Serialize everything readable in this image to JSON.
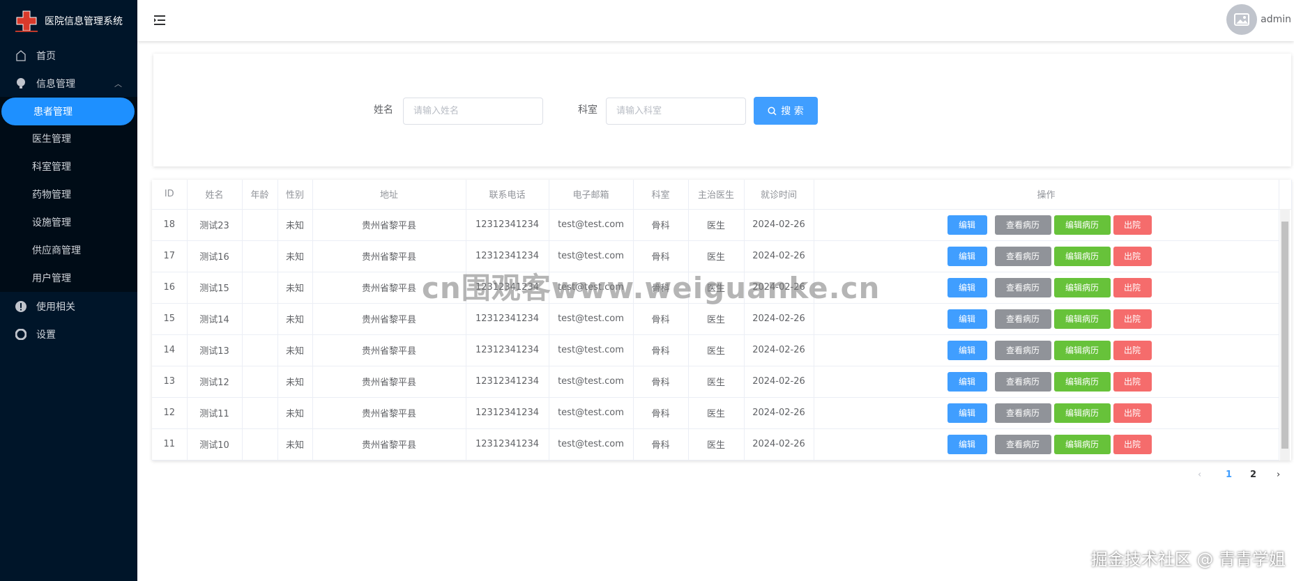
{
  "app": {
    "title": "医院信息管理系统",
    "user": "admin"
  },
  "sidebar": {
    "home": "首页",
    "info": "信息管理",
    "sub": [
      "患者管理",
      "医生管理",
      "科室管理",
      "药物管理",
      "设施管理",
      "供应商管理",
      "用户管理"
    ],
    "usage": "使用相关",
    "settings": "设置"
  },
  "search": {
    "name_label": "姓名",
    "name_placeholder": "请输入姓名",
    "dept_label": "科室",
    "dept_placeholder": "请输入科室",
    "button": "搜 索"
  },
  "table": {
    "headers": [
      "ID",
      "姓名",
      "年龄",
      "性别",
      "地址",
      "联系电话",
      "电子邮箱",
      "科室",
      "主治医生",
      "就诊时间",
      "操作"
    ],
    "rows": [
      [
        "18",
        "测试23",
        "",
        "未知",
        "贵州省黎平县",
        "12312341234",
        "test@test.com",
        "骨科",
        "医生",
        "2024-02-26"
      ],
      [
        "17",
        "测试16",
        "",
        "未知",
        "贵州省黎平县",
        "12312341234",
        "test@test.com",
        "骨科",
        "医生",
        "2024-02-26"
      ],
      [
        "16",
        "测试15",
        "",
        "未知",
        "贵州省黎平县",
        "12312341234",
        "test@test.com",
        "骨科",
        "医生",
        "2024-02-26"
      ],
      [
        "15",
        "测试14",
        "",
        "未知",
        "贵州省黎平县",
        "12312341234",
        "test@test.com",
        "骨科",
        "医生",
        "2024-02-26"
      ],
      [
        "14",
        "测试13",
        "",
        "未知",
        "贵州省黎平县",
        "12312341234",
        "test@test.com",
        "骨科",
        "医生",
        "2024-02-26"
      ],
      [
        "13",
        "测试12",
        "",
        "未知",
        "贵州省黎平县",
        "12312341234",
        "test@test.com",
        "骨科",
        "医生",
        "2024-02-26"
      ],
      [
        "12",
        "测试11",
        "",
        "未知",
        "贵州省黎平县",
        "12312341234",
        "test@test.com",
        "骨科",
        "医生",
        "2024-02-26"
      ],
      [
        "11",
        "测试10",
        "",
        "未知",
        "贵州省黎平县",
        "12312341234",
        "test@test.com",
        "骨科",
        "医生",
        "2024-02-26"
      ]
    ],
    "actions": [
      "编辑",
      "查看病历",
      "编辑病历",
      "出院"
    ]
  },
  "pagination": {
    "pages": [
      "1",
      "2"
    ],
    "current": "1"
  },
  "watermarks": {
    "center": "cn围观客www.weiguanke.cn",
    "corner": "掘金技术社区 @ 青青学姐"
  }
}
